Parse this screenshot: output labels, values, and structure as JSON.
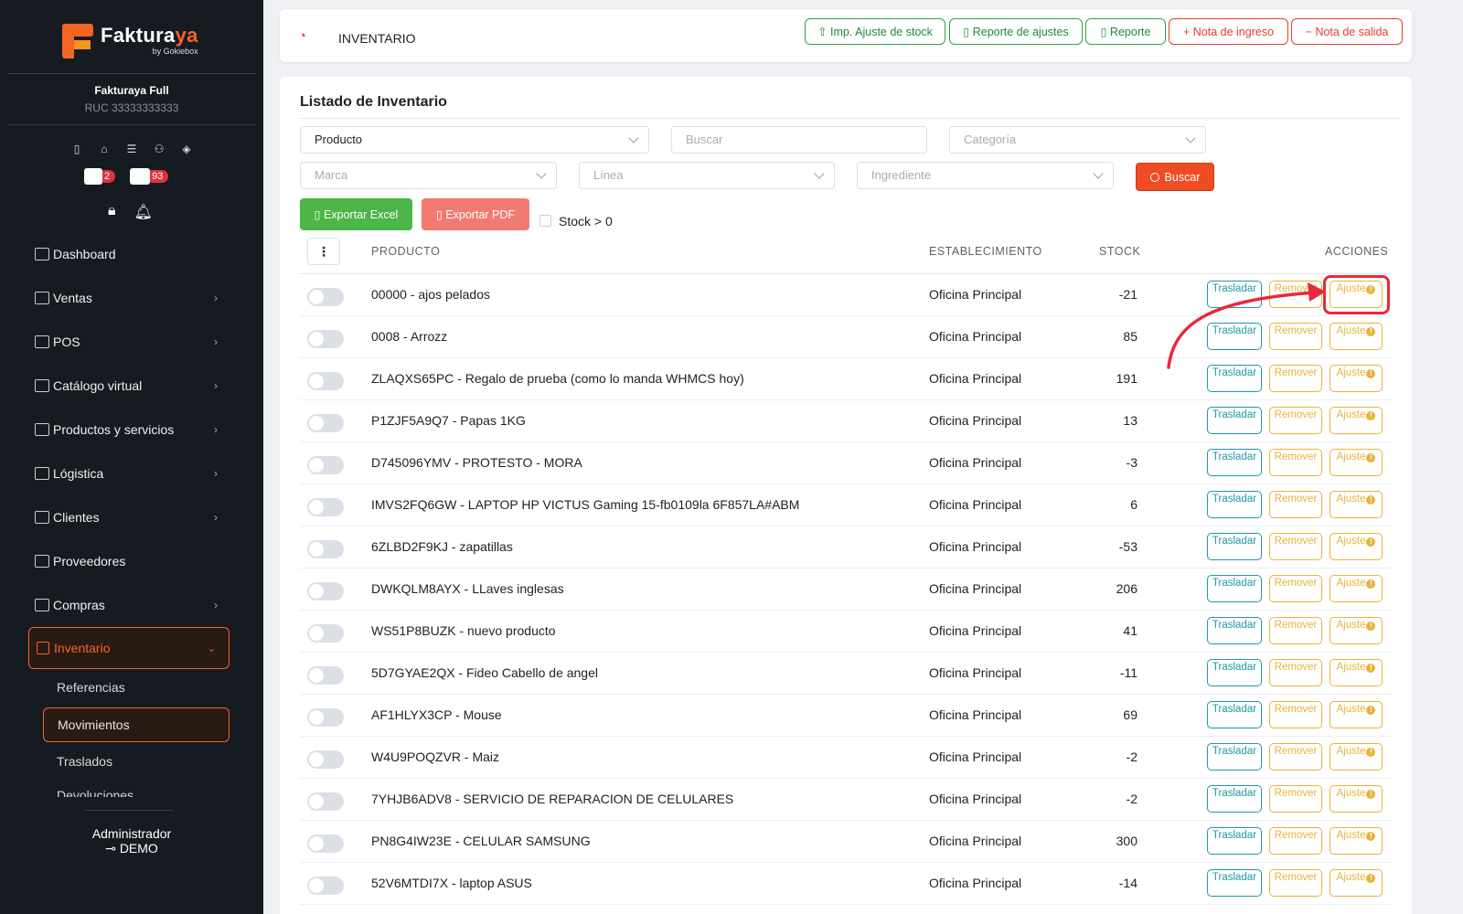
{
  "brand": {
    "name_main": "Fakturaya",
    "name_accent": "",
    "byline": "by Gokiebox"
  },
  "company": {
    "name": "Fakturaya Full",
    "ruc": "RUC 33333333333"
  },
  "badges": {
    "calendar_count": "2",
    "box_count": "93"
  },
  "nav": {
    "items": [
      {
        "label": "Dashboard"
      },
      {
        "label": "Ventas"
      },
      {
        "label": "POS"
      },
      {
        "label": "Catálogo virtual"
      },
      {
        "label": "Productos y servicios"
      },
      {
        "label": "Lógistica"
      },
      {
        "label": "Clientes"
      },
      {
        "label": "Proveedores"
      },
      {
        "label": "Compras"
      }
    ],
    "active": "Inventario",
    "sub": [
      "Referencias",
      "Movimientos",
      "Traslados",
      "Devoluciones"
    ]
  },
  "user": {
    "role": "Administrador",
    "name": "DEMO"
  },
  "header": {
    "title": "INVENTARIO",
    "buttons": {
      "imp": "Imp. Ajuste de stock",
      "reporte_ajustes": "Reporte de ajustes",
      "reporte": "Reporte",
      "nota_ingreso": "Nota de ingreso",
      "nota_salida": "Nota de salida"
    }
  },
  "main": {
    "title": "Listado de Inventario",
    "filters": {
      "tipo": "Producto",
      "buscar_placeholder": "Buscar",
      "categoria_placeholder": "Categoría",
      "marca_placeholder": "Marca",
      "linea_placeholder": "Línea",
      "ingrediente_placeholder": "Ingrediente",
      "buscar_btn": "Buscar"
    },
    "export_excel": "Exportar Excel",
    "export_pdf": "Exportar PDF",
    "stock_filter": "Stock > 0",
    "columns": {
      "producto": "PRODUCTO",
      "establecimiento": "ESTABLECIMIENTO",
      "stock": "STOCK",
      "acciones": "ACCIONES"
    },
    "actions": {
      "trasladar": "Trasladar",
      "remover": "Remover",
      "ajuste": "Ajuste"
    },
    "rows": [
      {
        "producto": "00000 - ajos pelados",
        "establecimiento": "Oficina Principal",
        "stock": "-21"
      },
      {
        "producto": "0008 - Arrozz",
        "establecimiento": "Oficina Principal",
        "stock": "85"
      },
      {
        "producto": "ZLAQXS65PC - Regalo de prueba (como lo manda WHMCS hoy)",
        "establecimiento": "Oficina Principal",
        "stock": "191"
      },
      {
        "producto": "P1ZJF5A9Q7 - Papas 1KG",
        "establecimiento": "Oficina Principal",
        "stock": "13"
      },
      {
        "producto": "D745096YMV - PROTESTO - MORA",
        "establecimiento": "Oficina Principal",
        "stock": "-3"
      },
      {
        "producto": "IMVS2FQ6GW - LAPTOP HP VICTUS Gaming 15-fb0109la 6F857LA#ABM",
        "establecimiento": "Oficina Principal",
        "stock": "6"
      },
      {
        "producto": "6ZLBD2F9KJ - zapatillas",
        "establecimiento": "Oficina Principal",
        "stock": "-53"
      },
      {
        "producto": "DWKQLM8AYX - LLaves inglesas",
        "establecimiento": "Oficina Principal",
        "stock": "206"
      },
      {
        "producto": "WS51P8BUZK - nuevo producto",
        "establecimiento": "Oficina Principal",
        "stock": "41"
      },
      {
        "producto": "5D7GYAE2QX - Fideo Cabello de angel",
        "establecimiento": "Oficina Principal",
        "stock": "-11"
      },
      {
        "producto": "AF1HLYX3CP - Mouse",
        "establecimiento": "Oficina Principal",
        "stock": "69"
      },
      {
        "producto": "W4U9POQZVR - Maiz",
        "establecimiento": "Oficina Principal",
        "stock": "-2"
      },
      {
        "producto": "7YHJB6ADV8 - SERVICIO DE REPARACION DE CELULARES",
        "establecimiento": "Oficina Principal",
        "stock": "-2"
      },
      {
        "producto": "PN8G4IW23E - CELULAR SAMSUNG",
        "establecimiento": "Oficina Principal",
        "stock": "300"
      },
      {
        "producto": "52V6MTDI7X - laptop ASUS",
        "establecimiento": "Oficina Principal",
        "stock": "-14"
      }
    ]
  },
  "colors": {
    "accent": "#f26522",
    "sidebar": "#161b22",
    "green": "#28a745",
    "red": "#e0412b",
    "teal": "#1d97a8",
    "amber": "#e8b33a",
    "highlight": "#e8293a"
  }
}
